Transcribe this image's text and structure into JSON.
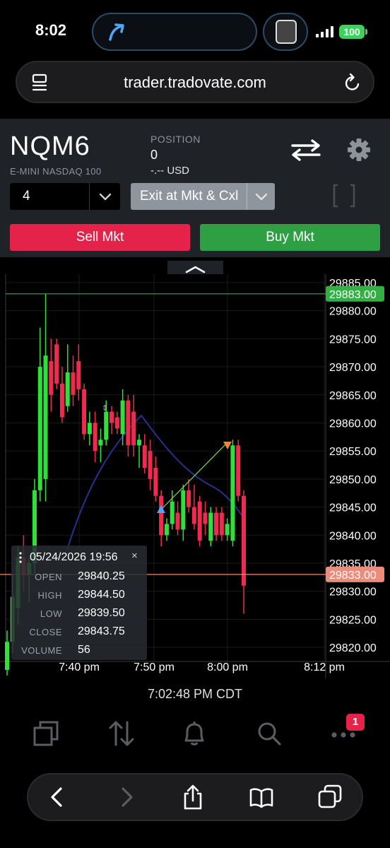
{
  "status_bar": {
    "time": "8:02",
    "battery": "100"
  },
  "browser": {
    "url": "trader.tradovate.com"
  },
  "contract": {
    "symbol": "NQM6",
    "description": "E-MINI NASDAQ 100",
    "position_label": "POSITION",
    "position_value": "0",
    "pnl": "-.-- USD"
  },
  "order": {
    "quantity": "4",
    "exit_option": "Exit at Mkt & Cxl",
    "sell_label": "Sell Mkt",
    "buy_label": "Buy Mkt"
  },
  "colors": {
    "bull": "#2fe03a",
    "bear": "#ee2b4e",
    "sell": "#e4224a",
    "buy": "#2ea043",
    "last_price_line": "#32b043",
    "bid_line": "#f08a7a"
  },
  "chart_data": {
    "type": "candlestick",
    "price_axis_labels": [
      "29885.00",
      "29880.00",
      "29875.00",
      "29870.00",
      "29865.00",
      "29860.00",
      "29855.00",
      "29850.00",
      "29845.00",
      "29840.00",
      "29835.00",
      "29830.00",
      "29825.00",
      "29820.00"
    ],
    "time_axis_labels": [
      "7:40 pm",
      "7:50 pm",
      "8:00 pm",
      "8:12 pm"
    ],
    "last_price_tag": "29883.00",
    "marker_price_tag": "29833.00",
    "ylim": [
      29817.5,
      29886.5
    ],
    "candles": [
      {
        "o": 29816,
        "h": 29823,
        "l": 29815,
        "c": 29821
      },
      {
        "o": 29821,
        "h": 29833,
        "l": 29819,
        "c": 29829
      },
      {
        "o": 29827,
        "h": 29838,
        "l": 29824,
        "c": 29836
      },
      {
        "o": 29836,
        "h": 29840,
        "l": 29830,
        "c": 29833
      },
      {
        "o": 29833,
        "h": 29836,
        "l": 29828,
        "c": 29835
      },
      {
        "o": 29835,
        "h": 29850,
        "l": 29833,
        "c": 29848
      },
      {
        "o": 29848,
        "h": 29877,
        "l": 29846,
        "c": 29870
      },
      {
        "o": 29850,
        "h": 29883,
        "l": 29846,
        "c": 29872
      },
      {
        "o": 29871,
        "h": 29875,
        "l": 29862,
        "c": 29865
      },
      {
        "o": 29874,
        "h": 29875,
        "l": 29866,
        "c": 29867
      },
      {
        "o": 29867,
        "h": 29870,
        "l": 29860,
        "c": 29861
      },
      {
        "o": 29863,
        "h": 29874,
        "l": 29862,
        "c": 29869
      },
      {
        "o": 29869,
        "h": 29872,
        "l": 29863,
        "c": 29865
      },
      {
        "o": 29871,
        "h": 29874,
        "l": 29864,
        "c": 29866
      },
      {
        "o": 29866,
        "h": 29867,
        "l": 29857,
        "c": 29858
      },
      {
        "o": 29858,
        "h": 29862,
        "l": 29856,
        "c": 29860
      },
      {
        "o": 29860,
        "h": 29862,
        "l": 29853,
        "c": 29855
      },
      {
        "o": 29856,
        "h": 29859,
        "l": 29853,
        "c": 29857
      },
      {
        "o": 29857,
        "h": 29864,
        "l": 29856,
        "c": 29862
      },
      {
        "o": 29862,
        "h": 29863,
        "l": 29858,
        "c": 29860
      },
      {
        "o": 29861,
        "h": 29862,
        "l": 29858,
        "c": 29859
      },
      {
        "o": 29858,
        "h": 29866,
        "l": 29856,
        "c": 29864
      },
      {
        "o": 29864,
        "h": 29865,
        "l": 29854,
        "c": 29856
      },
      {
        "o": 29862,
        "h": 29865,
        "l": 29854,
        "c": 29856
      },
      {
        "o": 29856,
        "h": 29858,
        "l": 29852,
        "c": 29857
      },
      {
        "o": 29856,
        "h": 29858,
        "l": 29851,
        "c": 29852
      },
      {
        "o": 29855,
        "h": 29857,
        "l": 29848,
        "c": 29850
      },
      {
        "o": 29852,
        "h": 29854,
        "l": 29846,
        "c": 29847
      },
      {
        "o": 29847,
        "h": 29848,
        "l": 29838,
        "c": 29840
      },
      {
        "o": 29840,
        "h": 29843,
        "l": 29839,
        "c": 29842
      },
      {
        "o": 29842,
        "h": 29848,
        "l": 29841,
        "c": 29846
      },
      {
        "o": 29844,
        "h": 29846,
        "l": 29840,
        "c": 29841
      },
      {
        "o": 29841,
        "h": 29849,
        "l": 29839,
        "c": 29848
      },
      {
        "o": 29848,
        "h": 29850,
        "l": 29844,
        "c": 29845
      },
      {
        "o": 29845,
        "h": 29849,
        "l": 29841,
        "c": 29842
      },
      {
        "o": 29846,
        "h": 29847,
        "l": 29838,
        "c": 29839
      },
      {
        "o": 29844,
        "h": 29846,
        "l": 29840,
        "c": 29842
      },
      {
        "o": 29839,
        "h": 29845,
        "l": 29838,
        "c": 29844
      },
      {
        "o": 29844,
        "h": 29845,
        "l": 29839,
        "c": 29840
      },
      {
        "o": 29844,
        "h": 29845,
        "l": 29839,
        "c": 29840
      },
      {
        "o": 29840,
        "h": 29843,
        "l": 29839,
        "c": 29842
      },
      {
        "o": 29839,
        "h": 29857,
        "l": 29838,
        "c": 29856
      },
      {
        "o": 29856,
        "h": 29857,
        "l": 29846,
        "c": 29847
      },
      {
        "o": 29847,
        "h": 29848,
        "l": 29826,
        "c": 29831
      }
    ]
  },
  "ohlc_tooltip": {
    "date": "05/24/2026 19:56",
    "open_label": "OPEN",
    "open": "29840.25",
    "high_label": "HIGH",
    "high": "29844.50",
    "low_label": "LOW",
    "low": "29839.50",
    "close_label": "CLOSE",
    "close": "29843.75",
    "volume_label": "VOLUME",
    "volume": "56"
  },
  "footer": {
    "clock": "7:02:48 PM CDT",
    "notification_count": "1"
  }
}
